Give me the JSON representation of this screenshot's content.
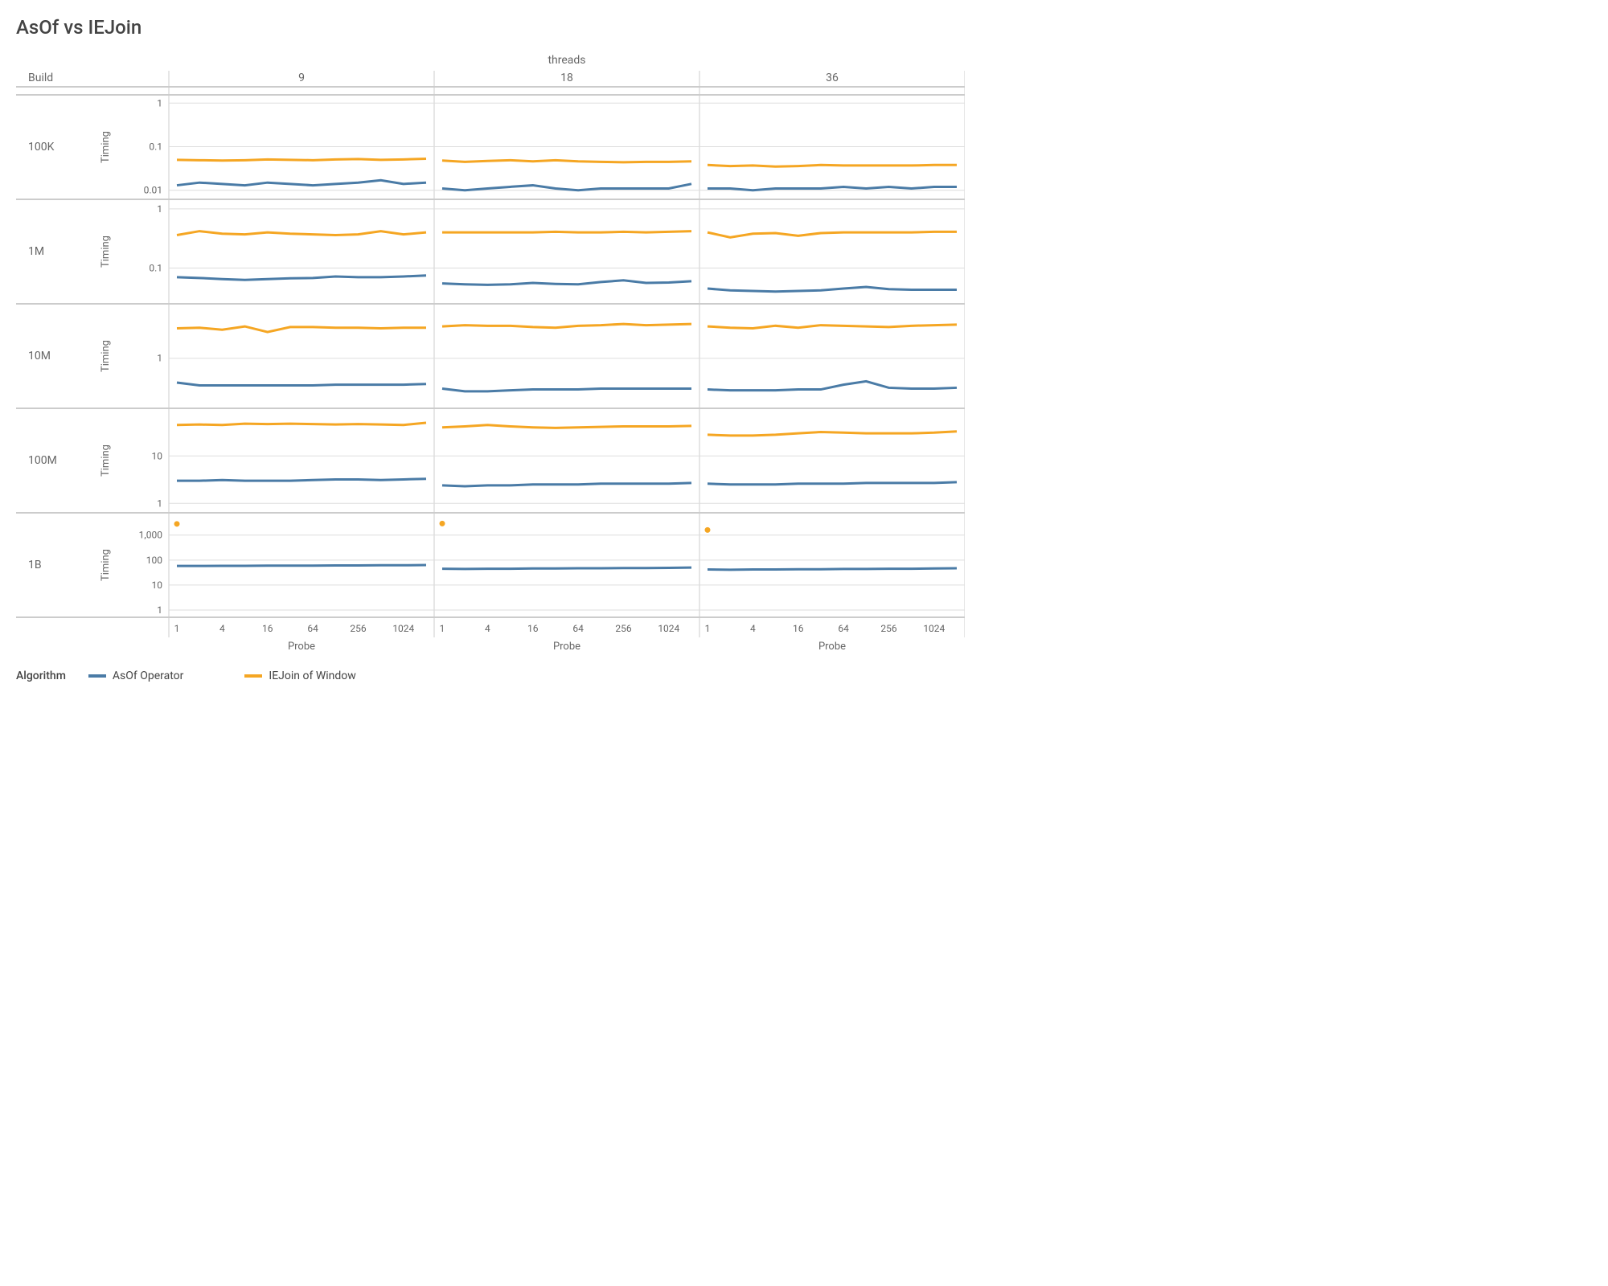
{
  "title": "AsOf vs IEJoin",
  "facets": {
    "col_header": "threads",
    "cols": [
      "9",
      "18",
      "36"
    ],
    "row_header": "Build",
    "rows": [
      "100K",
      "1M",
      "10M",
      "100M",
      "1B"
    ]
  },
  "axes": {
    "xlabel": "Probe",
    "x_ticks": [
      "1",
      "4",
      "16",
      "64",
      "256",
      "1024"
    ],
    "ylabel": "Timing",
    "y_ticks_by_row": {
      "100K": [
        "1",
        "0.1",
        "0.01"
      ],
      "1M": [
        "1",
        "0.1"
      ],
      "10M": [
        "1"
      ],
      "100M": [
        "10",
        "1"
      ],
      "1B": [
        "1,000",
        "100",
        "10",
        "1"
      ]
    },
    "y_range_by_row": {
      "100K": [
        0.008,
        1.2
      ],
      "1M": [
        0.03,
        1.2
      ],
      "10M": [
        0.15,
        8
      ],
      "100M": [
        0.8,
        80
      ],
      "1B": [
        0.8,
        5000
      ]
    }
  },
  "legend": {
    "label": "Algorithm",
    "series": [
      {
        "name": "AsOf Operator",
        "color": "#4a7ba6"
      },
      {
        "name": "IEJoin of Window",
        "color": "#f5a623"
      }
    ]
  },
  "chart_data": {
    "type": "line",
    "x": [
      1,
      2,
      4,
      8,
      16,
      32,
      64,
      128,
      256,
      512,
      1024,
      2048
    ],
    "panels": {
      "100K": {
        "9": {
          "asof": [
            0.013,
            0.015,
            0.014,
            0.013,
            0.015,
            0.014,
            0.013,
            0.014,
            0.015,
            0.017,
            0.014,
            0.015
          ],
          "iej": [
            0.05,
            0.049,
            0.048,
            0.049,
            0.051,
            0.05,
            0.049,
            0.051,
            0.052,
            0.05,
            0.051,
            0.053
          ]
        },
        "18": {
          "asof": [
            0.011,
            0.01,
            0.011,
            0.012,
            0.013,
            0.011,
            0.01,
            0.011,
            0.011,
            0.011,
            0.011,
            0.014
          ],
          "iej": [
            0.048,
            0.045,
            0.047,
            0.049,
            0.046,
            0.049,
            0.046,
            0.045,
            0.044,
            0.045,
            0.045,
            0.046
          ]
        },
        "36": {
          "asof": [
            0.011,
            0.011,
            0.01,
            0.011,
            0.011,
            0.011,
            0.012,
            0.011,
            0.012,
            0.011,
            0.012,
            0.012
          ],
          "iej": [
            0.038,
            0.036,
            0.037,
            0.035,
            0.036,
            0.038,
            0.037,
            0.037,
            0.037,
            0.037,
            0.038,
            0.038
          ]
        }
      },
      "1M": {
        "9": {
          "asof": [
            0.07,
            0.068,
            0.065,
            0.063,
            0.065,
            0.067,
            0.068,
            0.072,
            0.07,
            0.07,
            0.072,
            0.075
          ],
          "iej": [
            0.36,
            0.42,
            0.38,
            0.37,
            0.4,
            0.38,
            0.37,
            0.36,
            0.37,
            0.42,
            0.37,
            0.4
          ]
        },
        "18": {
          "asof": [
            0.055,
            0.053,
            0.052,
            0.053,
            0.056,
            0.054,
            0.053,
            0.058,
            0.062,
            0.056,
            0.057,
            0.06
          ],
          "iej": [
            0.4,
            0.4,
            0.4,
            0.4,
            0.4,
            0.41,
            0.4,
            0.4,
            0.41,
            0.4,
            0.41,
            0.42
          ]
        },
        "36": {
          "asof": [
            0.045,
            0.042,
            0.041,
            0.04,
            0.041,
            0.042,
            0.045,
            0.048,
            0.044,
            0.043,
            0.043,
            0.043
          ],
          "iej": [
            0.4,
            0.33,
            0.38,
            0.39,
            0.35,
            0.39,
            0.4,
            0.4,
            0.4,
            0.4,
            0.41,
            0.41
          ]
        }
      },
      "10M": {
        "9": {
          "asof": [
            0.36,
            0.32,
            0.32,
            0.32,
            0.32,
            0.32,
            0.32,
            0.33,
            0.33,
            0.33,
            0.33,
            0.34
          ],
          "iej": [
            3.5,
            3.6,
            3.3,
            3.8,
            3.0,
            3.7,
            3.7,
            3.6,
            3.6,
            3.5,
            3.6,
            3.6
          ]
        },
        "18": {
          "asof": [
            0.28,
            0.25,
            0.25,
            0.26,
            0.27,
            0.27,
            0.27,
            0.28,
            0.28,
            0.28,
            0.28,
            0.28
          ],
          "iej": [
            3.8,
            4.0,
            3.9,
            3.9,
            3.7,
            3.6,
            3.9,
            4.0,
            4.2,
            4.0,
            4.1,
            4.2
          ]
        },
        "36": {
          "asof": [
            0.27,
            0.26,
            0.26,
            0.26,
            0.27,
            0.27,
            0.33,
            0.38,
            0.29,
            0.28,
            0.28,
            0.29
          ],
          "iej": [
            3.8,
            3.6,
            3.5,
            3.9,
            3.6,
            4.0,
            3.9,
            3.8,
            3.7,
            3.9,
            4.0,
            4.1
          ]
        }
      },
      "100M": {
        "9": {
          "asof": [
            3.0,
            3.0,
            3.1,
            3.0,
            3.0,
            3.0,
            3.1,
            3.2,
            3.2,
            3.1,
            3.2,
            3.3
          ],
          "iej": [
            45,
            46,
            45,
            48,
            47,
            48,
            47,
            46,
            47,
            46,
            45,
            50
          ]
        },
        "18": {
          "asof": [
            2.4,
            2.3,
            2.4,
            2.4,
            2.5,
            2.5,
            2.5,
            2.6,
            2.6,
            2.6,
            2.6,
            2.7
          ],
          "iej": [
            40,
            42,
            45,
            42,
            40,
            39,
            40,
            41,
            42,
            42,
            42,
            43
          ]
        },
        "36": {
          "asof": [
            2.6,
            2.5,
            2.5,
            2.5,
            2.6,
            2.6,
            2.6,
            2.7,
            2.7,
            2.7,
            2.7,
            2.8
          ],
          "iej": [
            28,
            27,
            27,
            28,
            30,
            32,
            31,
            30,
            30,
            30,
            31,
            33
          ]
        }
      },
      "1B": {
        "9": {
          "asof": [
            58,
            58,
            59,
            59,
            60,
            60,
            60,
            61,
            61,
            62,
            62,
            63
          ],
          "iej_point": {
            "x": 1,
            "y": 2800
          }
        },
        "18": {
          "asof": [
            45,
            44,
            45,
            45,
            46,
            46,
            47,
            47,
            48,
            48,
            49,
            50
          ],
          "iej_point": {
            "x": 1,
            "y": 2900
          }
        },
        "36": {
          "asof": [
            42,
            41,
            42,
            42,
            43,
            43,
            44,
            44,
            45,
            45,
            46,
            47
          ],
          "iej_point": {
            "x": 1,
            "y": 1600
          }
        }
      }
    }
  }
}
